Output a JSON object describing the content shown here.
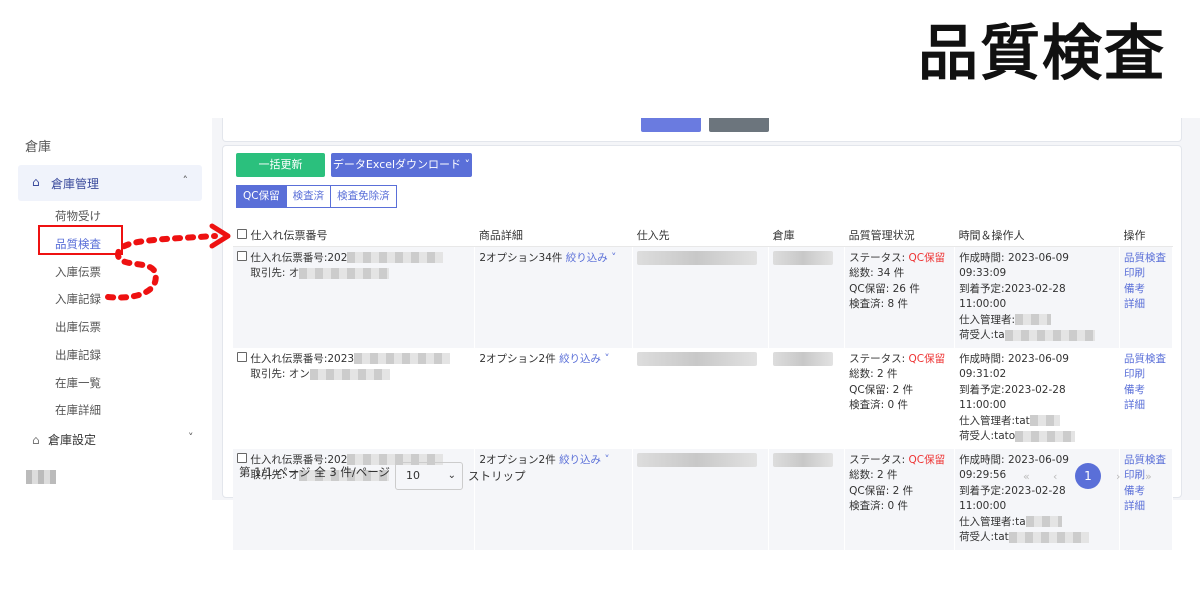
{
  "page_title": "品質検査",
  "sidebar": {
    "header": "倉庫",
    "group": {
      "label": "倉庫管理",
      "chevron": "˄"
    },
    "items": [
      "荷物受け",
      "品質検査",
      "入庫伝票",
      "入庫記録",
      "出庫伝票",
      "出庫記録",
      "在庫一覧",
      "在庫詳細"
    ],
    "settings": {
      "label": "倉庫設定",
      "chevron": "˅"
    }
  },
  "toolbar": {
    "bulk_update": "一括更新",
    "excel_download": "データExcelダウンロード ˅"
  },
  "tabs": [
    {
      "label": "QC保留",
      "active": true
    },
    {
      "label": "検査済",
      "active": false
    },
    {
      "label": "検査免除済",
      "active": false
    }
  ],
  "table": {
    "headers": [
      "仕入れ伝票番号",
      "商品詳細",
      "仕入先",
      "倉庫",
      "品質管理状況",
      "時間＆操作人",
      "操作"
    ],
    "rows": [
      {
        "slip_no": "仕入れ伝票番号:202",
        "supplier_ref": "取引先: オ",
        "detail": "2オプション34件",
        "narrow": "絞り込み ˅",
        "status_label": "ステータス:",
        "status": "QC保留",
        "total": "総数: 34 件",
        "qc_hold": "QC保留: 26 件",
        "checked": "検査済: 8 件",
        "created": "作成時間: 2023-06-09 09:33:09",
        "eta": "到着予定:2023-02-28 11:00:00",
        "manager": "仕入管理者:",
        "receiver": "荷受人:ta",
        "actions": [
          "品質検査",
          "印刷",
          "備考",
          "詳細"
        ]
      },
      {
        "slip_no": "仕入れ伝票番号:2023",
        "supplier_ref": "取引先: オン",
        "detail": "2オプション2件",
        "narrow": "絞り込み ˅",
        "status_label": "ステータス:",
        "status": "QC保留",
        "total": "総数: 2 件",
        "qc_hold": "QC保留: 2 件",
        "checked": "検査済: 0 件",
        "created": "作成時間: 2023-06-09 09:31:02",
        "eta": "到着予定:2023-02-28 11:00:00",
        "manager": "仕入管理者:tat",
        "receiver": "荷受人:tato",
        "actions": [
          "品質検査",
          "印刷",
          "備考",
          "詳細"
        ]
      },
      {
        "slip_no": "仕入れ伝票番号:202",
        "supplier_ref": "取引先: オ",
        "detail": "2オプション2件",
        "narrow": "絞り込み ˅",
        "status_label": "ステータス:",
        "status": "QC保留",
        "total": "総数: 2 件",
        "qc_hold": "QC保留: 2 件",
        "checked": "検査済: 0 件",
        "created": "作成時間: 2023-06-09 09:29:56",
        "eta": "到着予定:2023-02-28 11:00:00",
        "manager": "仕入管理者:ta",
        "receiver": "荷受人:tat",
        "actions": [
          "品質検査",
          "印刷",
          "備考",
          "詳細"
        ]
      }
    ]
  },
  "pagination": {
    "summary": "第 1/1 ページ 全 3 件/ページ",
    "page_size": "10",
    "strip_label": "ストリップ",
    "first": "«",
    "prev": "‹",
    "current": "1",
    "next": "›",
    "last": "»"
  },
  "colors": {
    "accent": "#5a6fd8",
    "success": "#2bc07d",
    "danger": "#e33",
    "highlight": "#e11"
  }
}
